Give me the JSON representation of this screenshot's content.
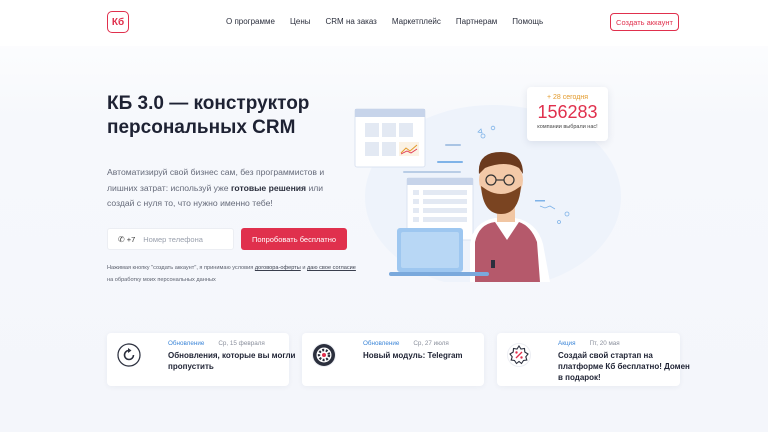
{
  "header": {
    "logo": "Кб",
    "nav": [
      "О программе",
      "Цены",
      "CRM на заказ",
      "Маркетплейс",
      "Партнерам",
      "Помощь"
    ],
    "create_account": "Создать аккаунт"
  },
  "hero": {
    "title": "КБ 3.0 — конструктор персональных CRM",
    "desc_before": "Автоматизируй свой бизнес сам, без программистов и лишних затрат: используй уже ",
    "desc_bold": "готовые решения",
    "desc_after": " или создай с нуля то, что нужно именно тебе!",
    "phone_code": "+7",
    "phone_placeholder": "Номер телефона",
    "try_button": "Попробовать бесплатно",
    "consent_before": "Нажимая кнопку \"создать аккаунт\", я принимаю условия ",
    "consent_link1": "договора-оферты",
    "consent_mid": " и ",
    "consent_link2": "даю свое согласие",
    "consent_after": " на обработку моих персональных данных"
  },
  "stats": {
    "today": "+ 28 сегодня",
    "count": "156283",
    "caption": "компании выбрали нас!"
  },
  "cards": [
    {
      "tag": "Обновление",
      "date": "Ср, 15 февраля",
      "title": "Обновления, которые вы могли пропустить",
      "icon": "refresh-icon"
    },
    {
      "tag": "Обновление",
      "date": "Ср, 27 июля",
      "title": "Новый модуль: Telegram",
      "icon": "gear-icon"
    },
    {
      "tag": "Акция",
      "date": "Пт, 20 мая",
      "title": "Создай свой стартап на платформе Кб бесплатно! Домен в подарок!",
      "icon": "discount-icon"
    }
  ],
  "colors": {
    "accent": "#e0304d",
    "tag": "#3c86d8",
    "stats_today": "#e39a2b"
  }
}
